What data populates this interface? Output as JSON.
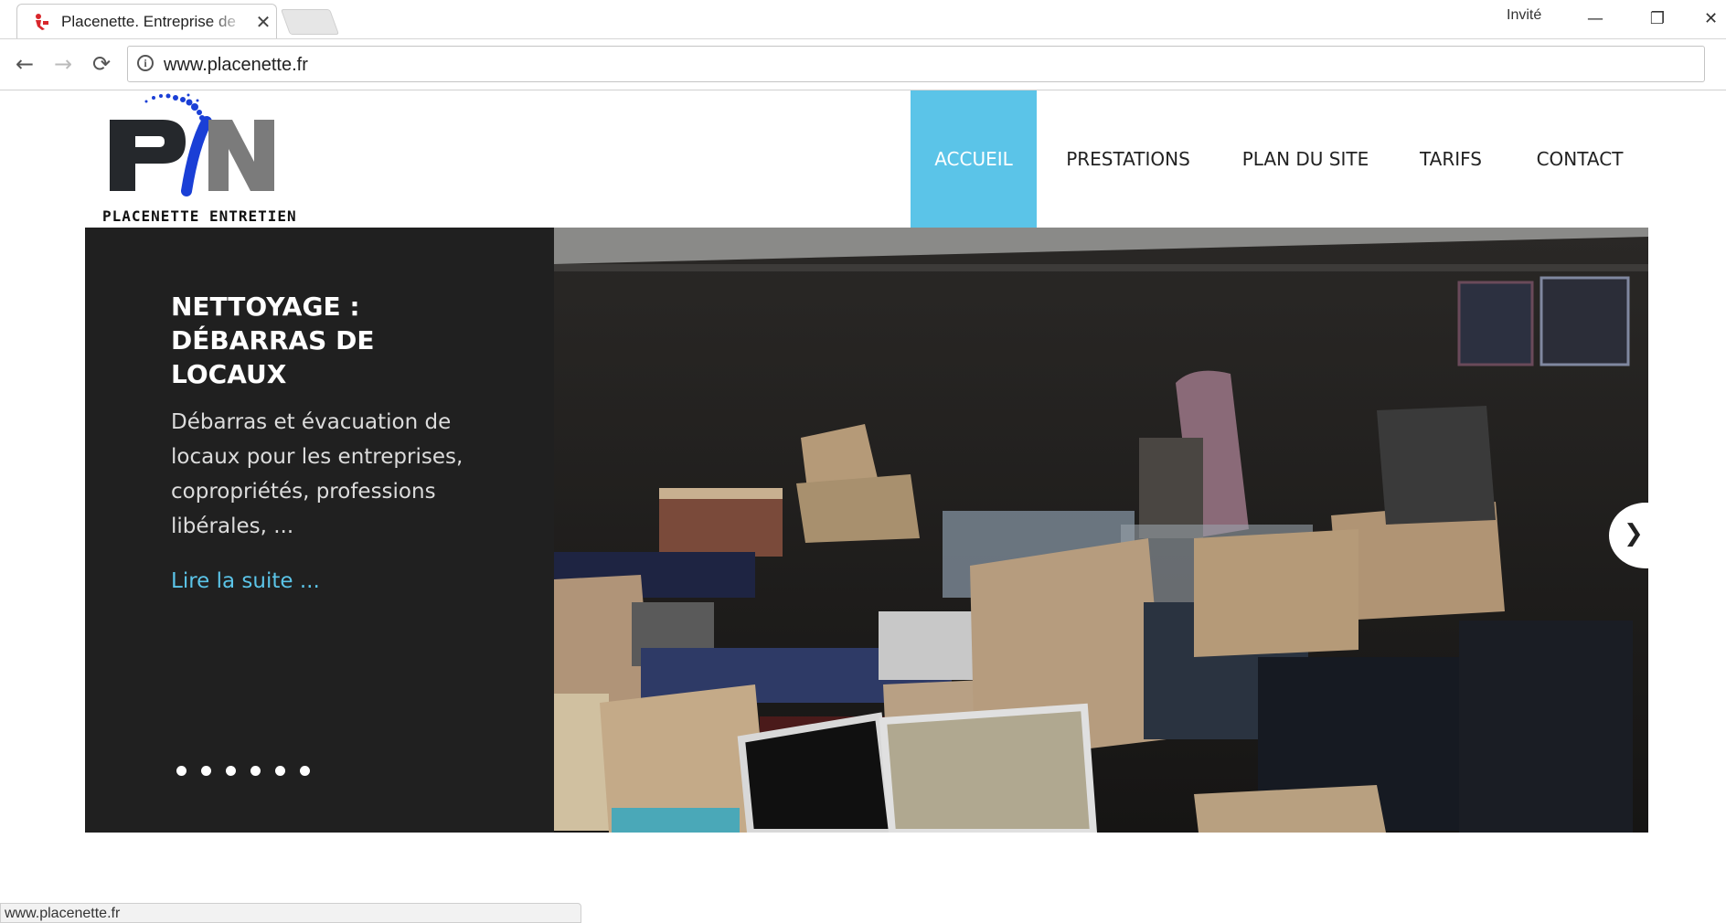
{
  "browser": {
    "tab_title": "Placenette. Entreprise de",
    "tab_close": "✕",
    "profile_label": "Invité",
    "window_controls": {
      "minimize": "—",
      "restore": "❐",
      "close": "✕"
    },
    "nav": {
      "back": "←",
      "forward": "→",
      "reload": "⟳"
    },
    "info_symbol": "i",
    "url": "www.placenette.fr",
    "status_url": "www.placenette.fr"
  },
  "site": {
    "logo_text": "PLACENETTE ENTRETIEN",
    "nav_items": [
      "ACCUEIL",
      "PRESTATIONS",
      "PLAN DU SITE",
      "TARIFS",
      "CONTACT"
    ],
    "active_nav": "ACCUEIL",
    "accent_color": "#5bc4e8"
  },
  "slider": {
    "title": "NETTOYAGE : DÉBARRAS DE LOCAUX",
    "description": "Débarras et évacuation de locaux pour les entreprises, copropriétés, professions libérales, ...",
    "read_more": "Lire la suite ...",
    "dots_count": 6,
    "next_icon": "chevron-right-icon"
  }
}
